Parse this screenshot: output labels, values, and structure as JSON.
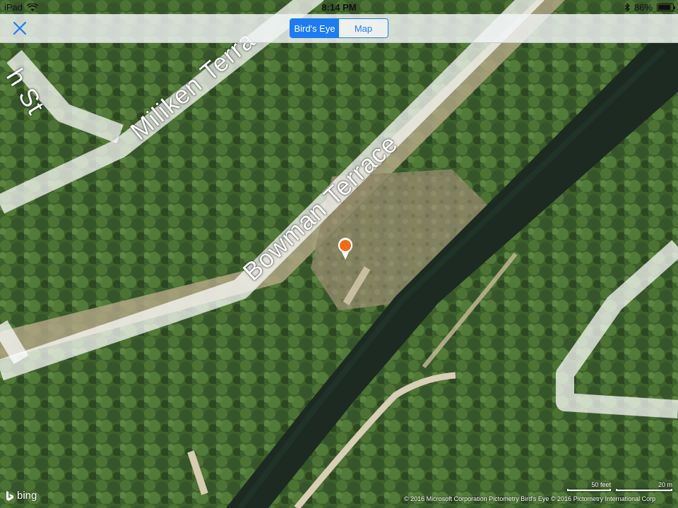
{
  "status_bar": {
    "device": "iPad",
    "time": "8:14 PM",
    "battery": "86%",
    "battery_level": 0.86
  },
  "nav": {
    "close_icon": "close-x-icon",
    "segments": [
      {
        "label": "Bird's Eye",
        "selected": true
      },
      {
        "label": "Map",
        "selected": false
      }
    ]
  },
  "map": {
    "view": "Bird's Eye",
    "roads": [
      {
        "name": "Bowman Terrace"
      },
      {
        "name": "Miliken Terra"
      },
      {
        "name": "h St"
      }
    ],
    "pin_color": "#f26a1b",
    "accent_color": "#1e7cf2"
  },
  "footer": {
    "logo": "bing",
    "copyright": "© 2016 Microsoft Corporation   Pictometry Bird's Eye © 2016 Pictometry International Corp",
    "scale_feet": "50 feet",
    "scale_meters": "20 m"
  }
}
